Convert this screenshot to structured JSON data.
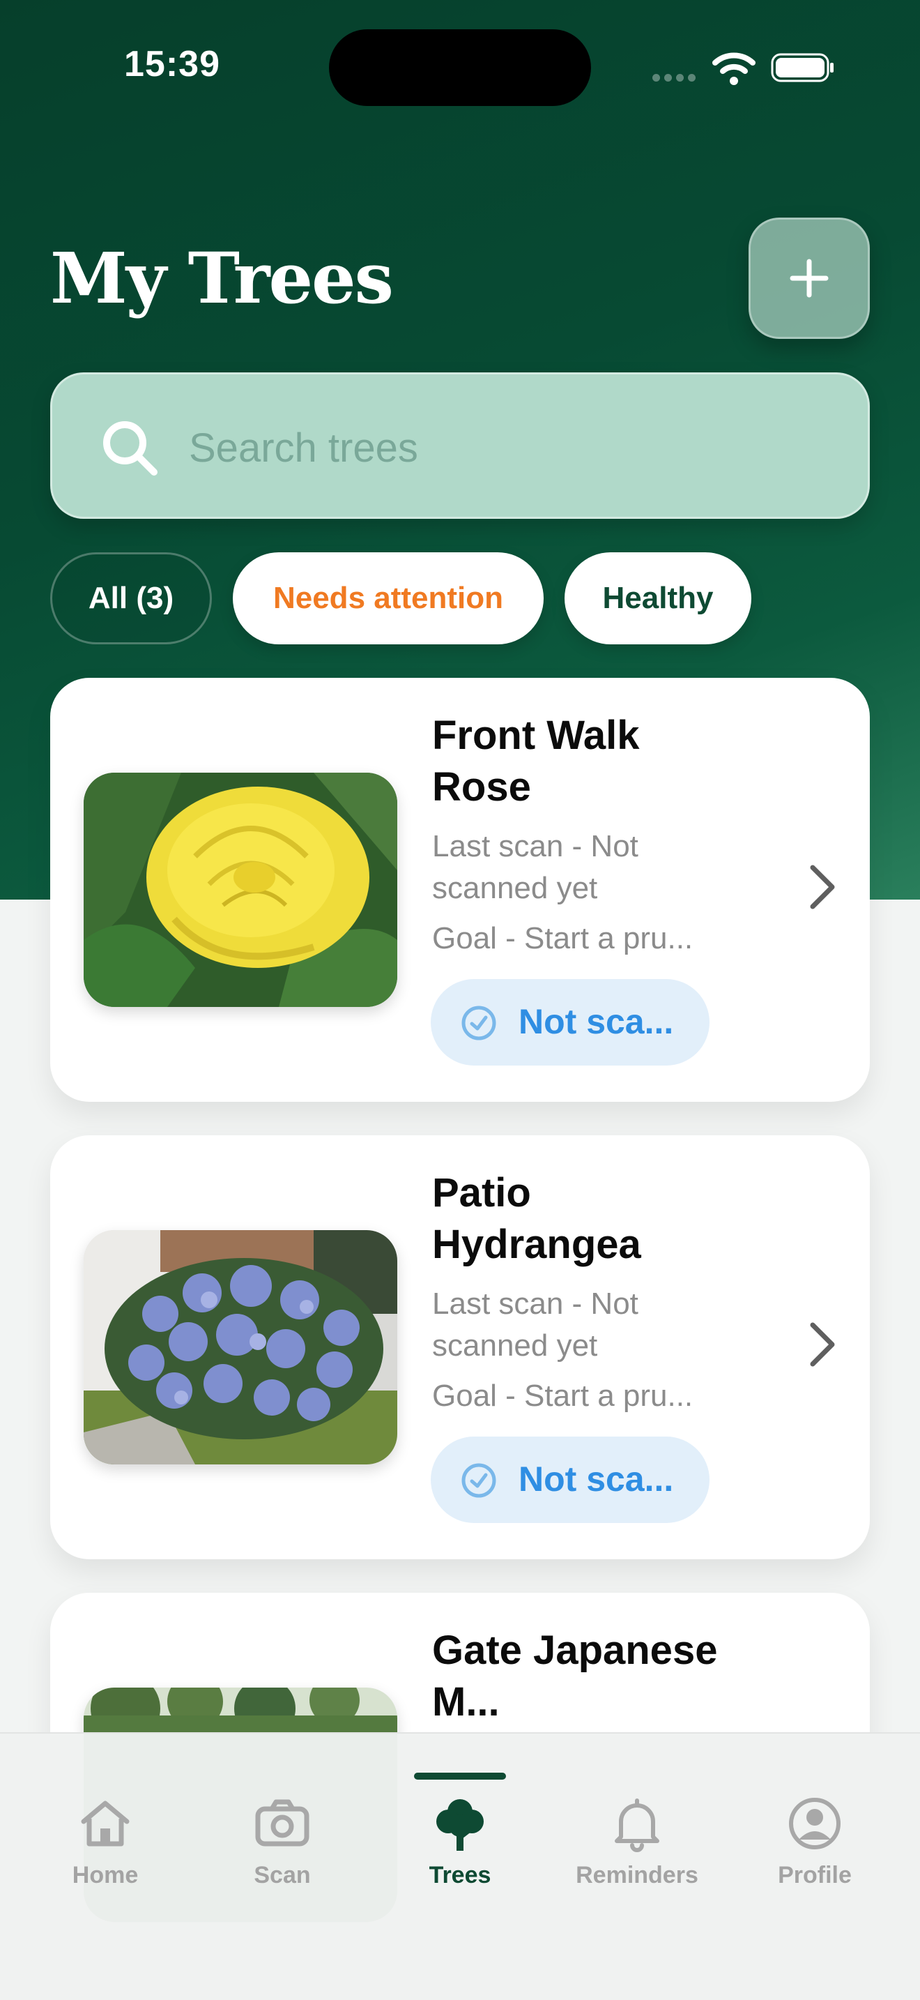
{
  "status_bar": {
    "time": "15:39",
    "icons": [
      "signal-icon",
      "wifi-icon",
      "battery-icon"
    ]
  },
  "header": {
    "title": "My Trees",
    "add_button_icon": "plus-icon"
  },
  "search": {
    "placeholder": "Search trees",
    "value": "",
    "icon": "search-icon"
  },
  "filters": [
    {
      "label": "All (3)",
      "selected": true
    },
    {
      "label": "Needs attention",
      "selected": false,
      "color": "#f07a22"
    },
    {
      "label": "Healthy",
      "selected": false,
      "color": "#0e4a33"
    }
  ],
  "trees": [
    {
      "name": "Front Walk Rose",
      "last_scan": "Last scan - Not scanned yet",
      "goal": "Goal - Start a pru...",
      "badge": "Not sca...",
      "image": "yellow-rose-photo"
    },
    {
      "name": "Patio Hydrangea",
      "last_scan": "Last scan - Not scanned yet",
      "goal": "Goal - Start a pru...",
      "badge": "Not sca...",
      "image": "hydrangea-bush-photo"
    },
    {
      "name": "Gate Japanese M...",
      "image": "japanese-maple-photo"
    }
  ],
  "tabs": [
    {
      "label": "Home",
      "icon": "home-icon",
      "active": false
    },
    {
      "label": "Scan",
      "icon": "camera-icon",
      "active": false
    },
    {
      "label": "Trees",
      "icon": "tree-icon",
      "active": true
    },
    {
      "label": "Reminders",
      "icon": "bell-icon",
      "active": false
    },
    {
      "label": "Profile",
      "icon": "profile-icon",
      "active": false
    }
  ],
  "colors": {
    "brand_green": "#0e4a33",
    "accent_orange": "#f07a22",
    "badge_blue": "#2f8ee3"
  }
}
